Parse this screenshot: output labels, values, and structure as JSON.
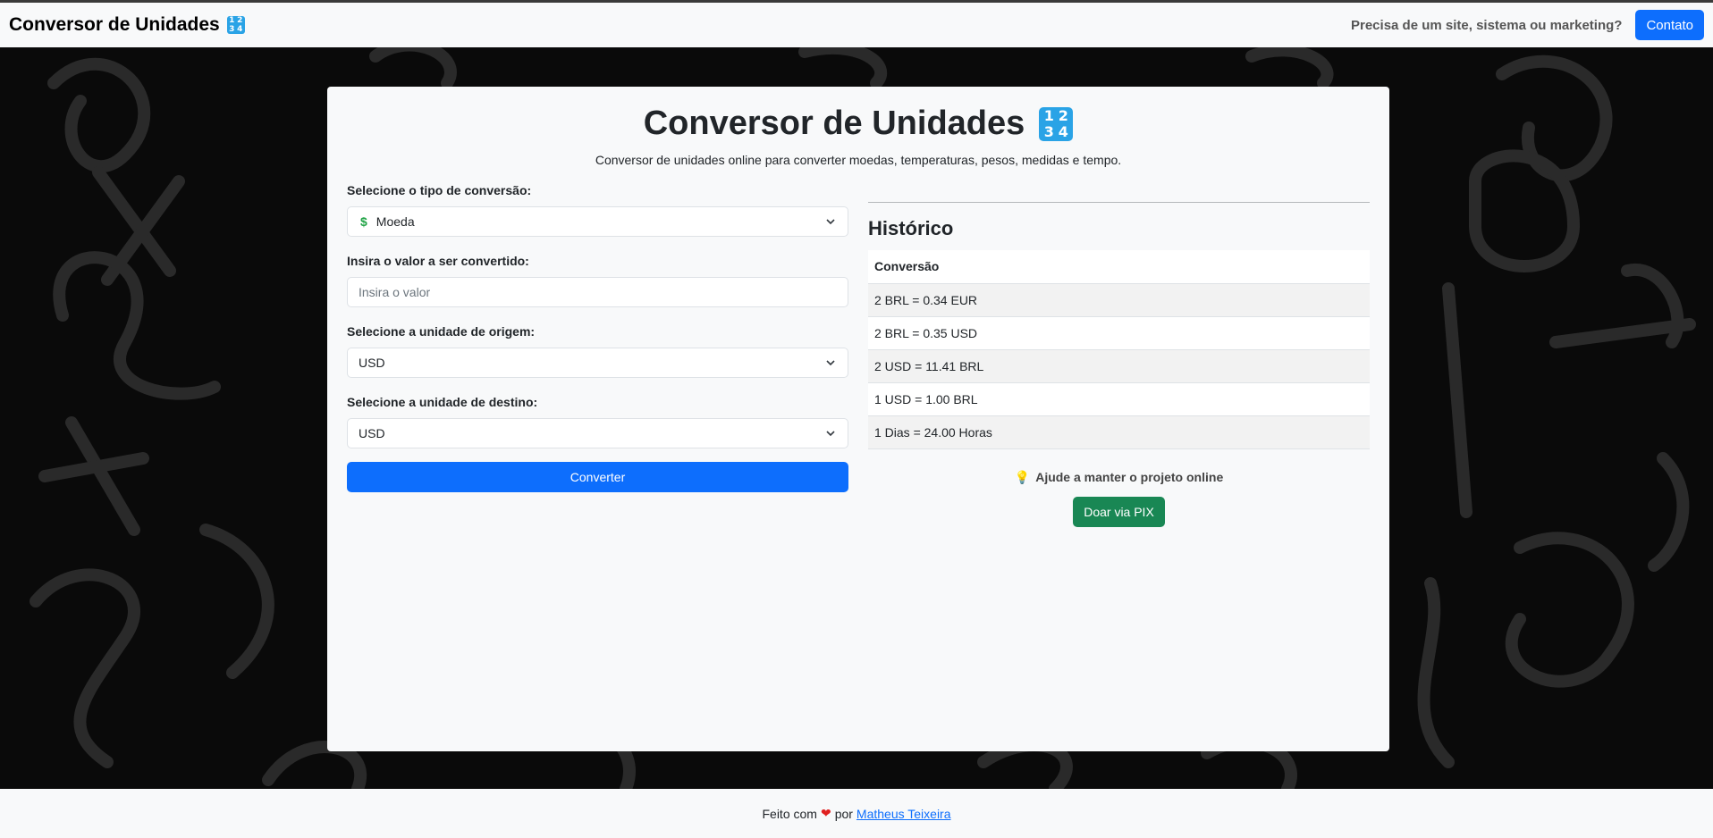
{
  "navbar": {
    "brand": "Conversor de Unidades",
    "brand_icon": "input-numbers-icon",
    "tagline": "Precisa de um site, sistema ou marketing?",
    "contact_label": "Contato"
  },
  "main": {
    "title": "Conversor de Unidades",
    "subtitle": "Conversor de unidades online para converter moedas, temperaturas, pesos, medidas e tempo.",
    "form": {
      "type_label": "Selecione o tipo de conversão:",
      "type_value": "Moeda",
      "value_label": "Insira o valor a ser convertido:",
      "value_placeholder": "Insira o valor",
      "from_label": "Selecione a unidade de origem:",
      "from_value": "USD",
      "to_label": "Selecione a unidade de destino:",
      "to_value": "USD",
      "convert_label": "Converter"
    },
    "history": {
      "title": "Histórico",
      "column": "Conversão",
      "rows": [
        "2 BRL = 0.34 EUR",
        "2 BRL = 0.35 USD",
        "2 USD = 11.41 BRL",
        "1 USD = 1.00 BRL",
        "1 Dias = 24.00 Horas"
      ]
    },
    "donate": {
      "text": "Ajude a manter o projeto online",
      "button": "Doar via PIX"
    }
  },
  "footer": {
    "made_with": "Feito com",
    "by": "por",
    "author": "Matheus Teixeira"
  },
  "colors": {
    "primary": "#0d6efd",
    "success": "#198754",
    "badge": "#2aa3e6",
    "heart": "#e02020"
  }
}
